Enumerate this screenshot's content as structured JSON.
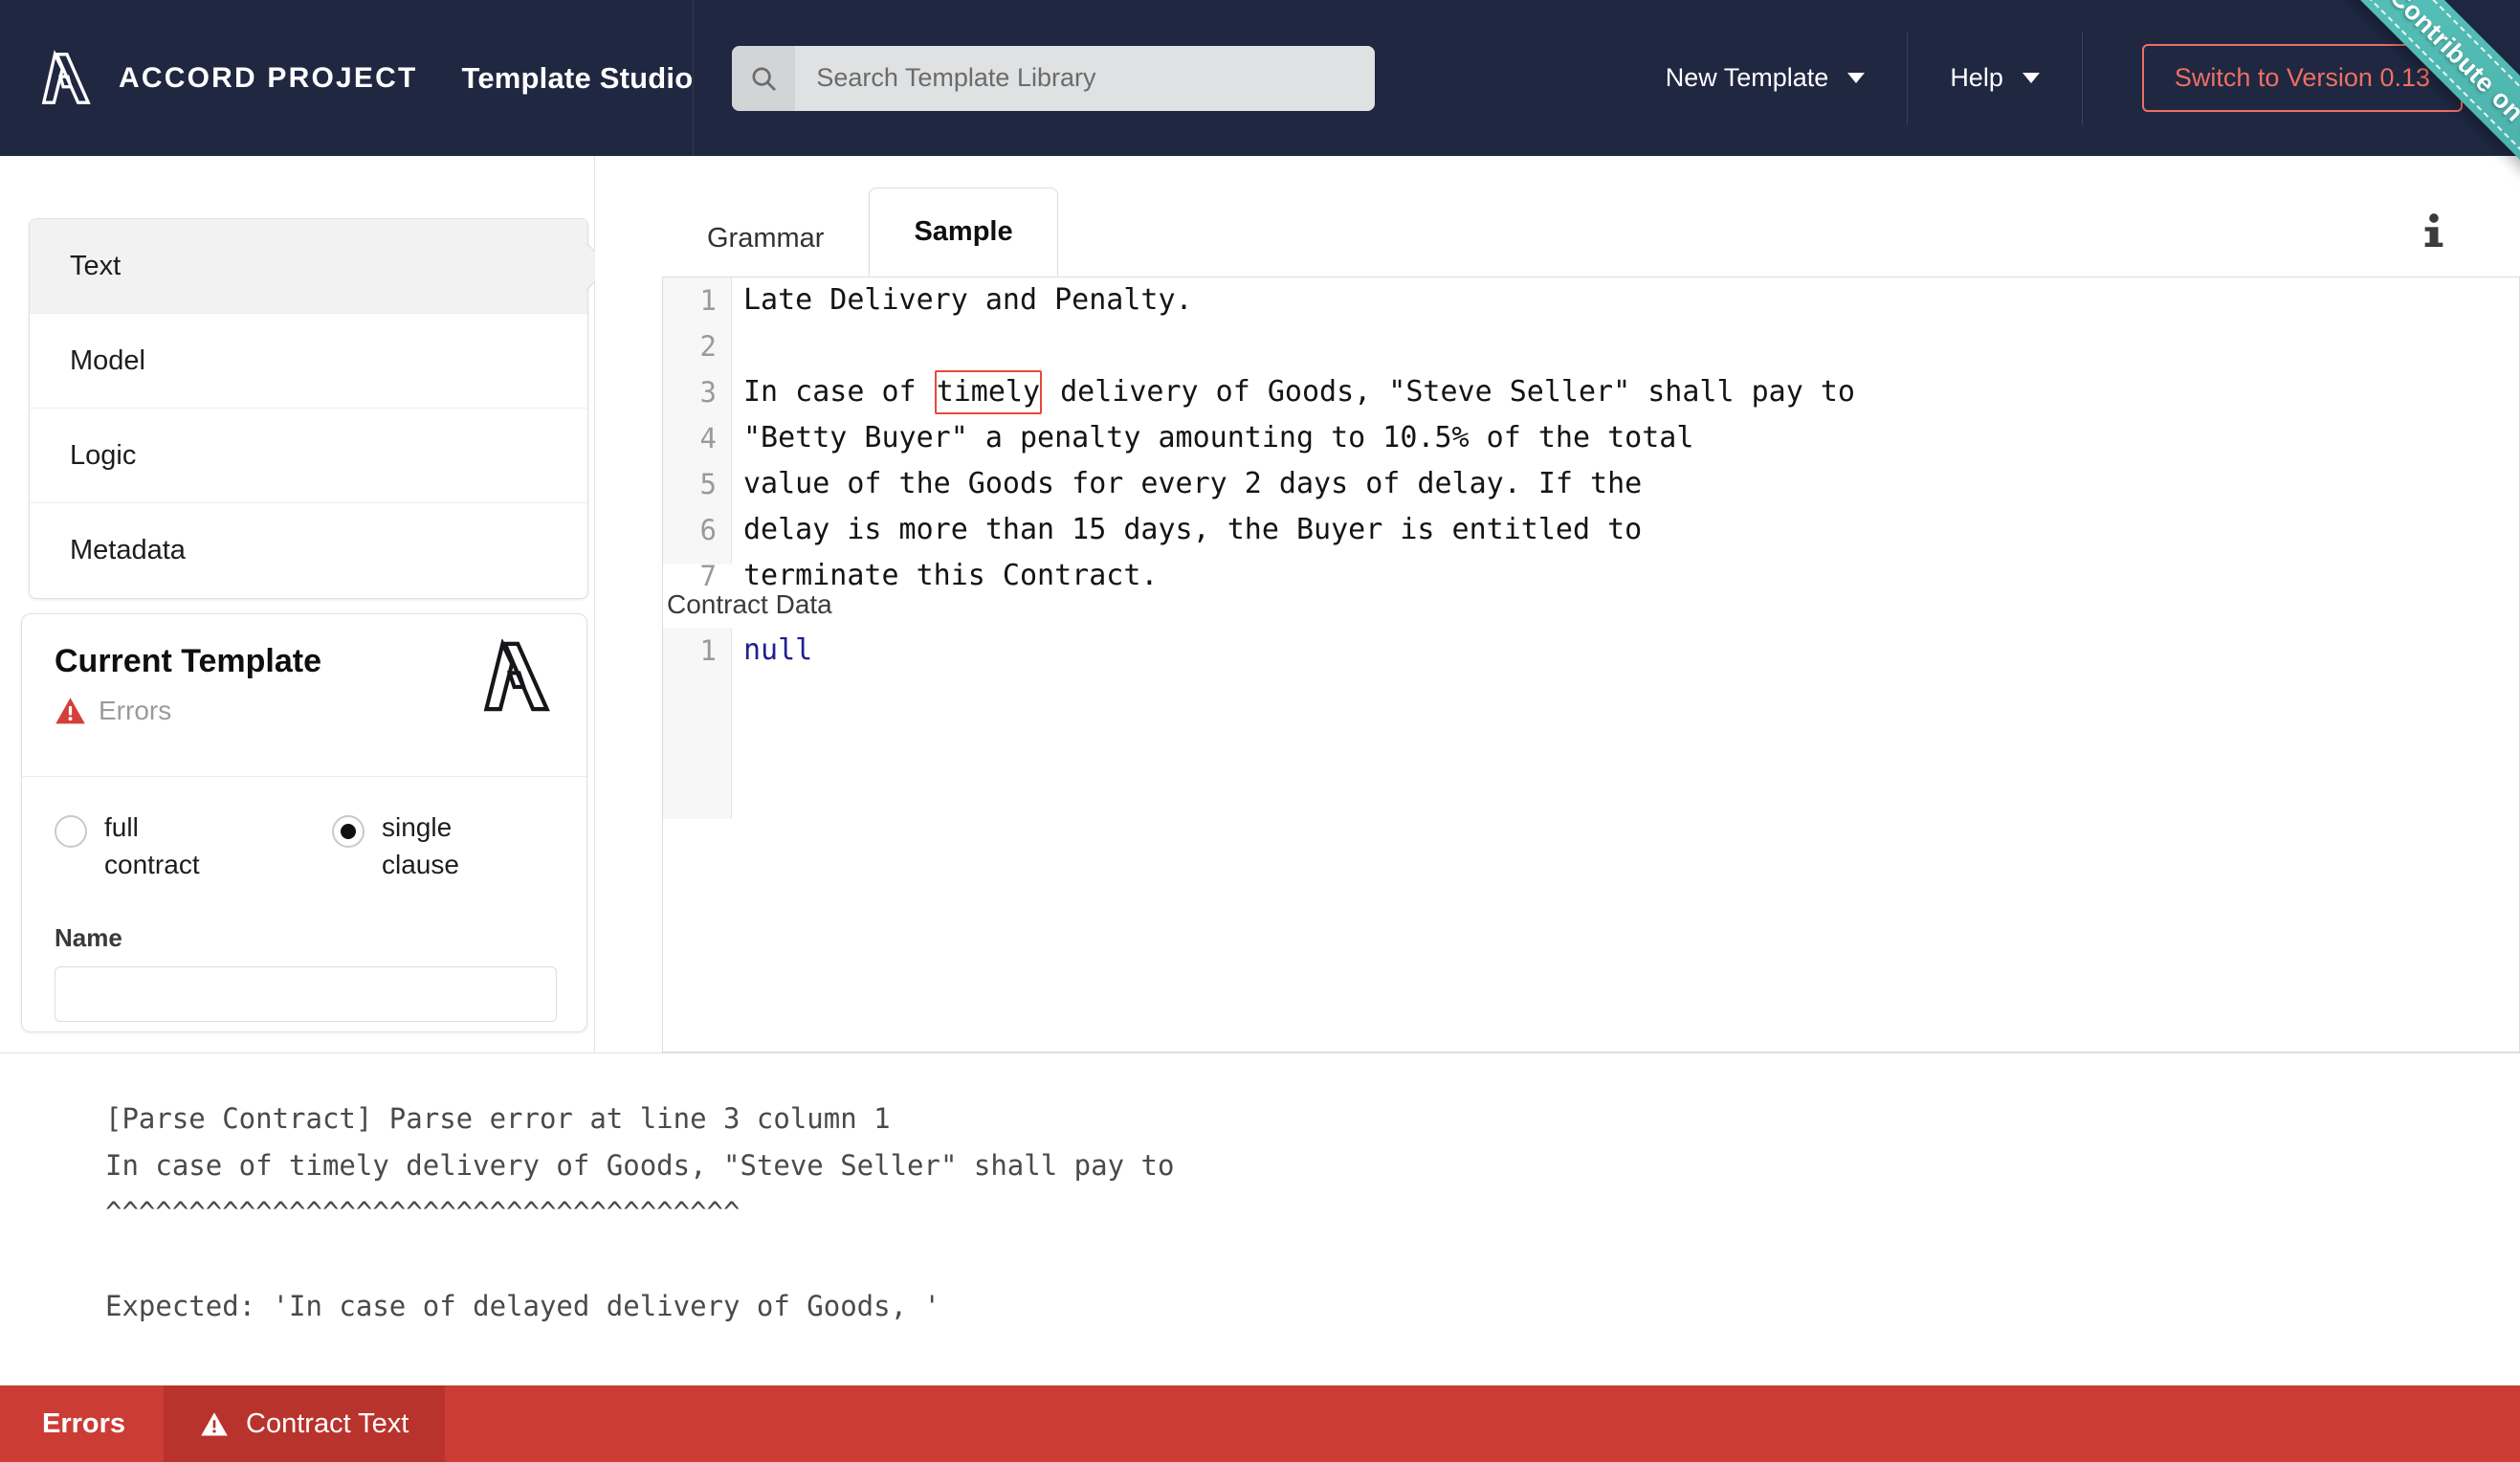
{
  "header": {
    "brand_name": "ACCORD PROJECT",
    "brand_logo_icon": "accord-project-logo-icon",
    "app_title": "Template Studio",
    "search": {
      "icon": "search-icon",
      "placeholder": "Search Template Library",
      "value": ""
    },
    "nav": [
      {
        "label": "New Template",
        "caret_icon": "chevron-down-icon"
      },
      {
        "label": "Help",
        "caret_icon": "chevron-down-icon"
      }
    ],
    "switch_button_label": "Switch to Version 0.13",
    "switch_button_color": "#ec7063",
    "ribbon": {
      "label": "Contribute on GitHub",
      "color": "#52b9b2"
    }
  },
  "sidebar": {
    "items": [
      {
        "label": "Text",
        "active": true
      },
      {
        "label": "Model",
        "active": false
      },
      {
        "label": "Logic",
        "active": false
      },
      {
        "label": "Metadata",
        "active": false
      }
    ]
  },
  "current_template": {
    "title": "Current Template",
    "status_icon": "warning-triangle-icon",
    "status_text": "Errors",
    "status_color": "#d43f3a",
    "logo_icon": "accord-project-logo-icon",
    "radio_options": [
      {
        "label": "full contract",
        "checked": false
      },
      {
        "label": "single clause",
        "checked": true
      }
    ],
    "name_field": {
      "label": "Name",
      "value": "",
      "placeholder": ""
    }
  },
  "editor": {
    "tabs": [
      {
        "label": "Grammar",
        "active": false
      },
      {
        "label": "Sample",
        "active": true
      }
    ],
    "info_icon": "info-icon",
    "sample": {
      "lines": [
        {
          "number": "1",
          "text": "Late Delivery and Penalty."
        },
        {
          "number": "2",
          "text": ""
        },
        {
          "number": "3",
          "pre": "In case of ",
          "error_token": "timely",
          "post": " delivery of Goods, \"Steve Seller\" shall pay to"
        },
        {
          "number": "4",
          "text": "\"Betty Buyer\" a penalty amounting to 10.5% of the total"
        },
        {
          "number": "5",
          "text": "value of the Goods for every 2 days of delay. If the"
        },
        {
          "number": "6",
          "text": "delay is more than 15 days, the Buyer is entitled to"
        },
        {
          "number": "7",
          "text": "terminate this Contract."
        }
      ],
      "error_token_color": "#e8483a"
    },
    "contract_data": {
      "heading": "Contract Data",
      "lines": [
        {
          "number": "1",
          "text": "null"
        }
      ],
      "value_color": "#1f1f8f"
    }
  },
  "console": {
    "text": "[Parse Contract] Parse error at line 3 column 1\nIn case of timely delivery of Goods, \"Steve Seller\" shall pay to\n^^^^^^^^^^^^^^^^^^^^^^^^^^^^^^^^^^^^^^\n\nExpected: 'In case of delayed delivery of Goods, '"
  },
  "statusbar": {
    "background": "#ca3c34",
    "label": "Errors",
    "tab": {
      "icon": "warning-triangle-icon",
      "label": "Contract Text",
      "active": true
    }
  }
}
